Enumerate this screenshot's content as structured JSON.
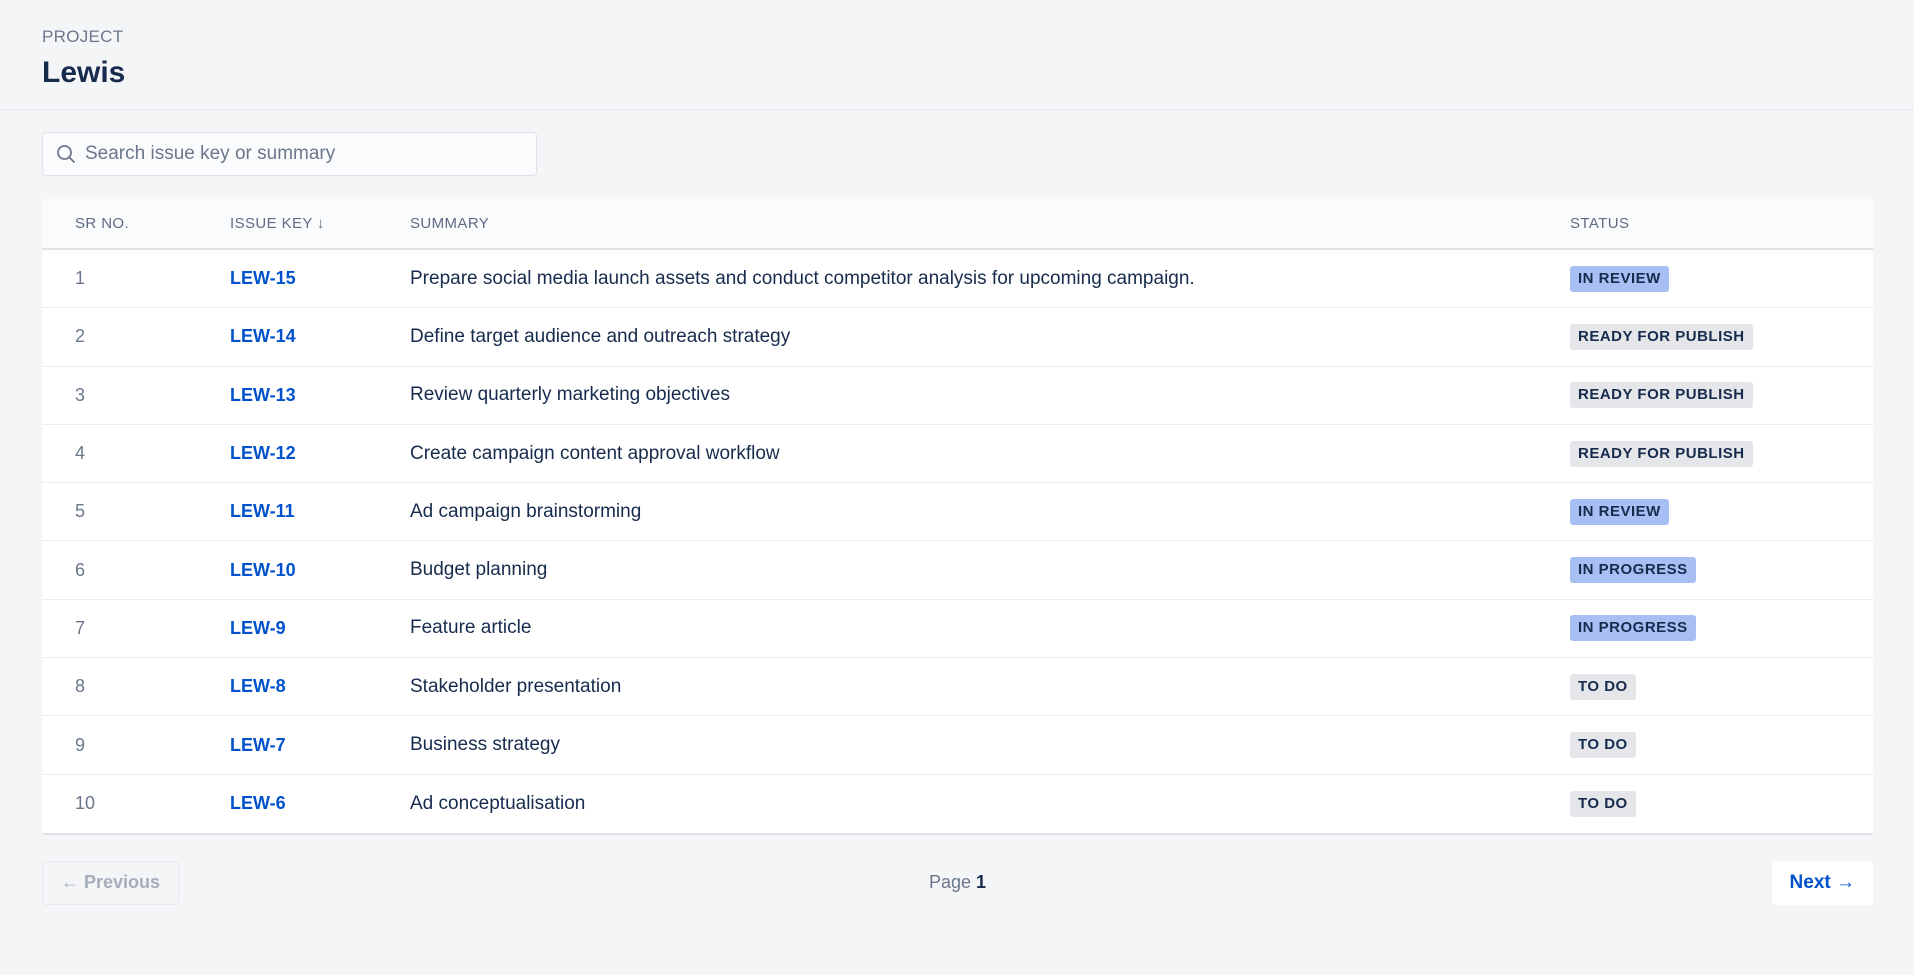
{
  "header": {
    "eyebrow": "PROJECT",
    "title": "Lewis"
  },
  "search": {
    "placeholder": "Search issue key or summary",
    "value": ""
  },
  "table": {
    "columns": {
      "sr": "SR NO.",
      "key": "ISSUE KEY",
      "sort_indicator": "↓",
      "summary": "SUMMARY",
      "status": "STATUS"
    },
    "rows": [
      {
        "sr": "1",
        "key": "LEW-15",
        "summary": "Prepare social media launch assets and conduct competitor analysis for upcoming campaign.",
        "status": "IN REVIEW",
        "tone": "blue"
      },
      {
        "sr": "2",
        "key": "LEW-14",
        "summary": "Define target audience and outreach strategy",
        "status": "READY FOR PUBLISH",
        "tone": "grey"
      },
      {
        "sr": "3",
        "key": "LEW-13",
        "summary": "Review quarterly marketing objectives",
        "status": "READY FOR PUBLISH",
        "tone": "grey"
      },
      {
        "sr": "4",
        "key": "LEW-12",
        "summary": "Create campaign content approval workflow",
        "status": "READY FOR PUBLISH",
        "tone": "grey"
      },
      {
        "sr": "5",
        "key": "LEW-11",
        "summary": "Ad campaign brainstorming",
        "status": "IN REVIEW",
        "tone": "blue"
      },
      {
        "sr": "6",
        "key": "LEW-10",
        "summary": "Budget planning",
        "status": "IN PROGRESS",
        "tone": "blue"
      },
      {
        "sr": "7",
        "key": "LEW-9",
        "summary": "Feature article",
        "status": "IN PROGRESS",
        "tone": "blue"
      },
      {
        "sr": "8",
        "key": "LEW-8",
        "summary": "Stakeholder presentation",
        "status": "TO DO",
        "tone": "grey"
      },
      {
        "sr": "9",
        "key": "LEW-7",
        "summary": "Business strategy",
        "status": "TO DO",
        "tone": "grey"
      },
      {
        "sr": "10",
        "key": "LEW-6",
        "summary": "Ad conceptualisation",
        "status": "TO DO",
        "tone": "grey"
      }
    ]
  },
  "pagination": {
    "previous": "← Previous",
    "page_label": "Page",
    "page_number": "1",
    "next": "Next →"
  },
  "colors": {
    "link": "#0052cc",
    "badge_blue": "#a7bff3",
    "badge_grey": "#e4e6ea"
  },
  "icons": {
    "search": "search-icon"
  }
}
